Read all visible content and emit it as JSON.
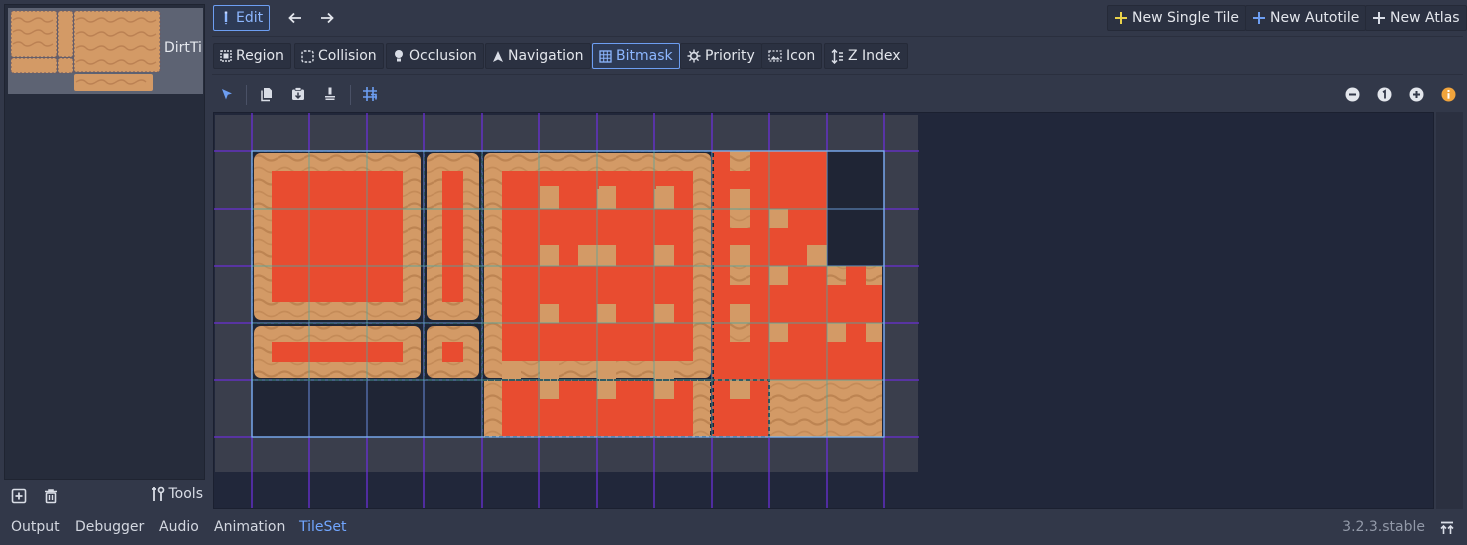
{
  "tileset_list": {
    "items": [
      {
        "label": "DirtTil"
      }
    ],
    "tools_label": "Tools"
  },
  "toolbar": {
    "edit_label": "Edit",
    "new_single_tile_label": "New Single Tile",
    "new_autotile_label": "New Autotile",
    "new_atlas_label": "New Atlas"
  },
  "modes": {
    "region": "Region",
    "collision": "Collision",
    "occlusion": "Occlusion",
    "navigation": "Navigation",
    "bitmask": "Bitmask",
    "priority": "Priority",
    "icon": "Icon",
    "z_index": "Z Index",
    "selected": "Bitmask"
  },
  "bottom_panel": {
    "tabs": [
      "Output",
      "Debugger",
      "Audio",
      "Animation",
      "TileSet"
    ],
    "active_tab": "TileSet",
    "version": "3.2.3.stable"
  },
  "colors": {
    "accent": "#6d9ef2",
    "add_icon": "#e9d24a",
    "add_icon_blue": "#6d9ef2",
    "bitmask_red": "#e84c30",
    "dirt_tan": "#d39a66",
    "info_orange": "#f1a43c"
  },
  "icons": {
    "edit": "edit-icon",
    "undo": "arrow-left-icon",
    "redo": "arrow-right-icon",
    "select": "select-arrow-icon",
    "copy": "copy-icon",
    "paste": "paste-icon",
    "erase": "erase-icon",
    "snap": "grid-snap-icon",
    "zoom_out": "zoom-out-icon",
    "zoom_reset": "zoom-reset-icon",
    "zoom_in": "zoom-in-icon",
    "info": "info-icon"
  }
}
